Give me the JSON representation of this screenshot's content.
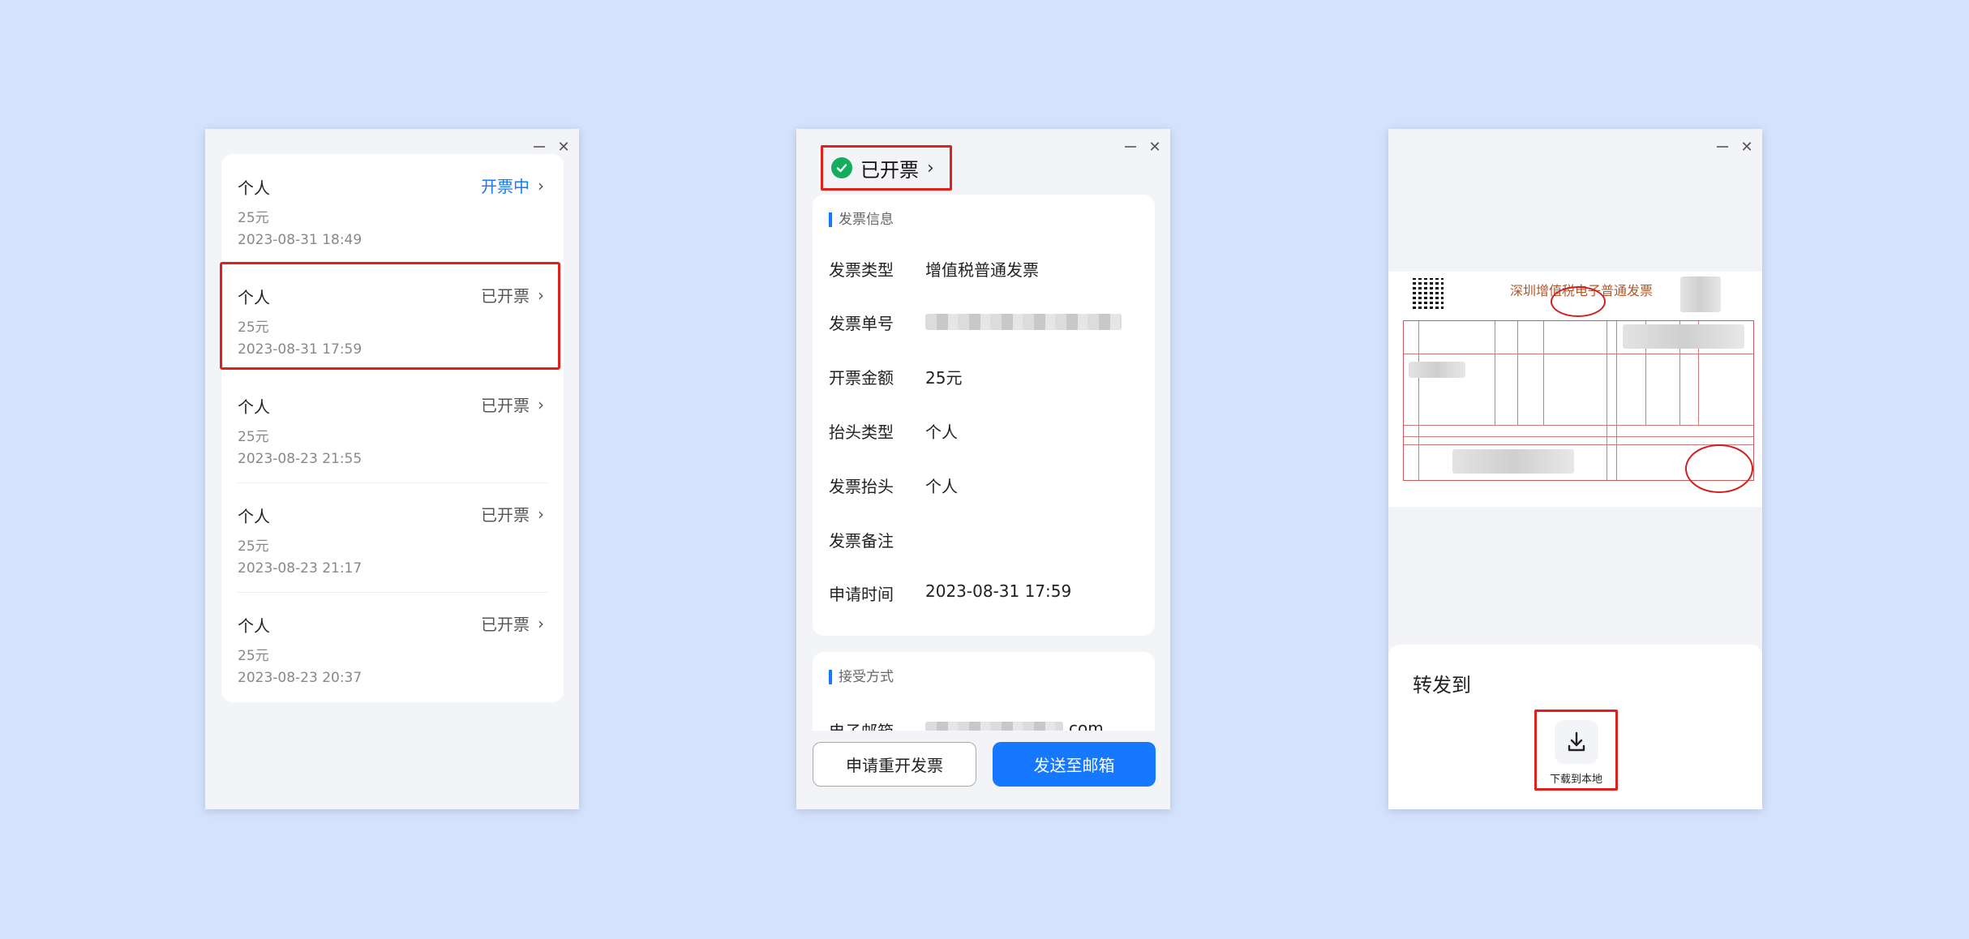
{
  "window_controls": {
    "minimize": "minimize-icon",
    "close": "close-icon",
    "close_glyph": "✕"
  },
  "invoice_list": {
    "items": [
      {
        "title": "个人",
        "amount": "25元",
        "time": "2023-08-31 18:49",
        "status": "开票中",
        "status_type": "processing"
      },
      {
        "title": "个人",
        "amount": "25元",
        "time": "2023-08-31 17:59",
        "status": "已开票",
        "status_type": "done"
      },
      {
        "title": "个人",
        "amount": "25元",
        "time": "2023-08-23 21:55",
        "status": "已开票",
        "status_type": "done"
      },
      {
        "title": "个人",
        "amount": "25元",
        "time": "2023-08-23 21:17",
        "status": "已开票",
        "status_type": "done"
      },
      {
        "title": "个人",
        "amount": "25元",
        "time": "2023-08-23 20:37",
        "status": "已开票",
        "status_type": "done"
      }
    ],
    "chevron": "›"
  },
  "invoice_detail": {
    "status": "已开票",
    "status_icon": "check-circle-icon",
    "section_info": "发票信息",
    "rows": [
      {
        "label": "发票类型",
        "value": "增值税普通发票"
      },
      {
        "label": "发票单号",
        "value": ""
      },
      {
        "label": "开票金额",
        "value": "25元"
      },
      {
        "label": "抬头类型",
        "value": "个人"
      },
      {
        "label": "发票抬头",
        "value": "个人"
      },
      {
        "label": "发票备注",
        "value": ""
      },
      {
        "label": "申请时间",
        "value": "2023-08-31 17:59"
      }
    ],
    "section_receive": "接受方式",
    "email_label": "电子邮箱",
    "email_suffix": "com",
    "btn_reissue": "申请重开发票",
    "btn_send": "发送至邮箱",
    "accent": "#1677ff"
  },
  "invoice_preview": {
    "title": "深圳增值税电子普通发票",
    "forward_title": "转发到",
    "download_label": "下载到本地",
    "download_icon": "download-icon"
  }
}
